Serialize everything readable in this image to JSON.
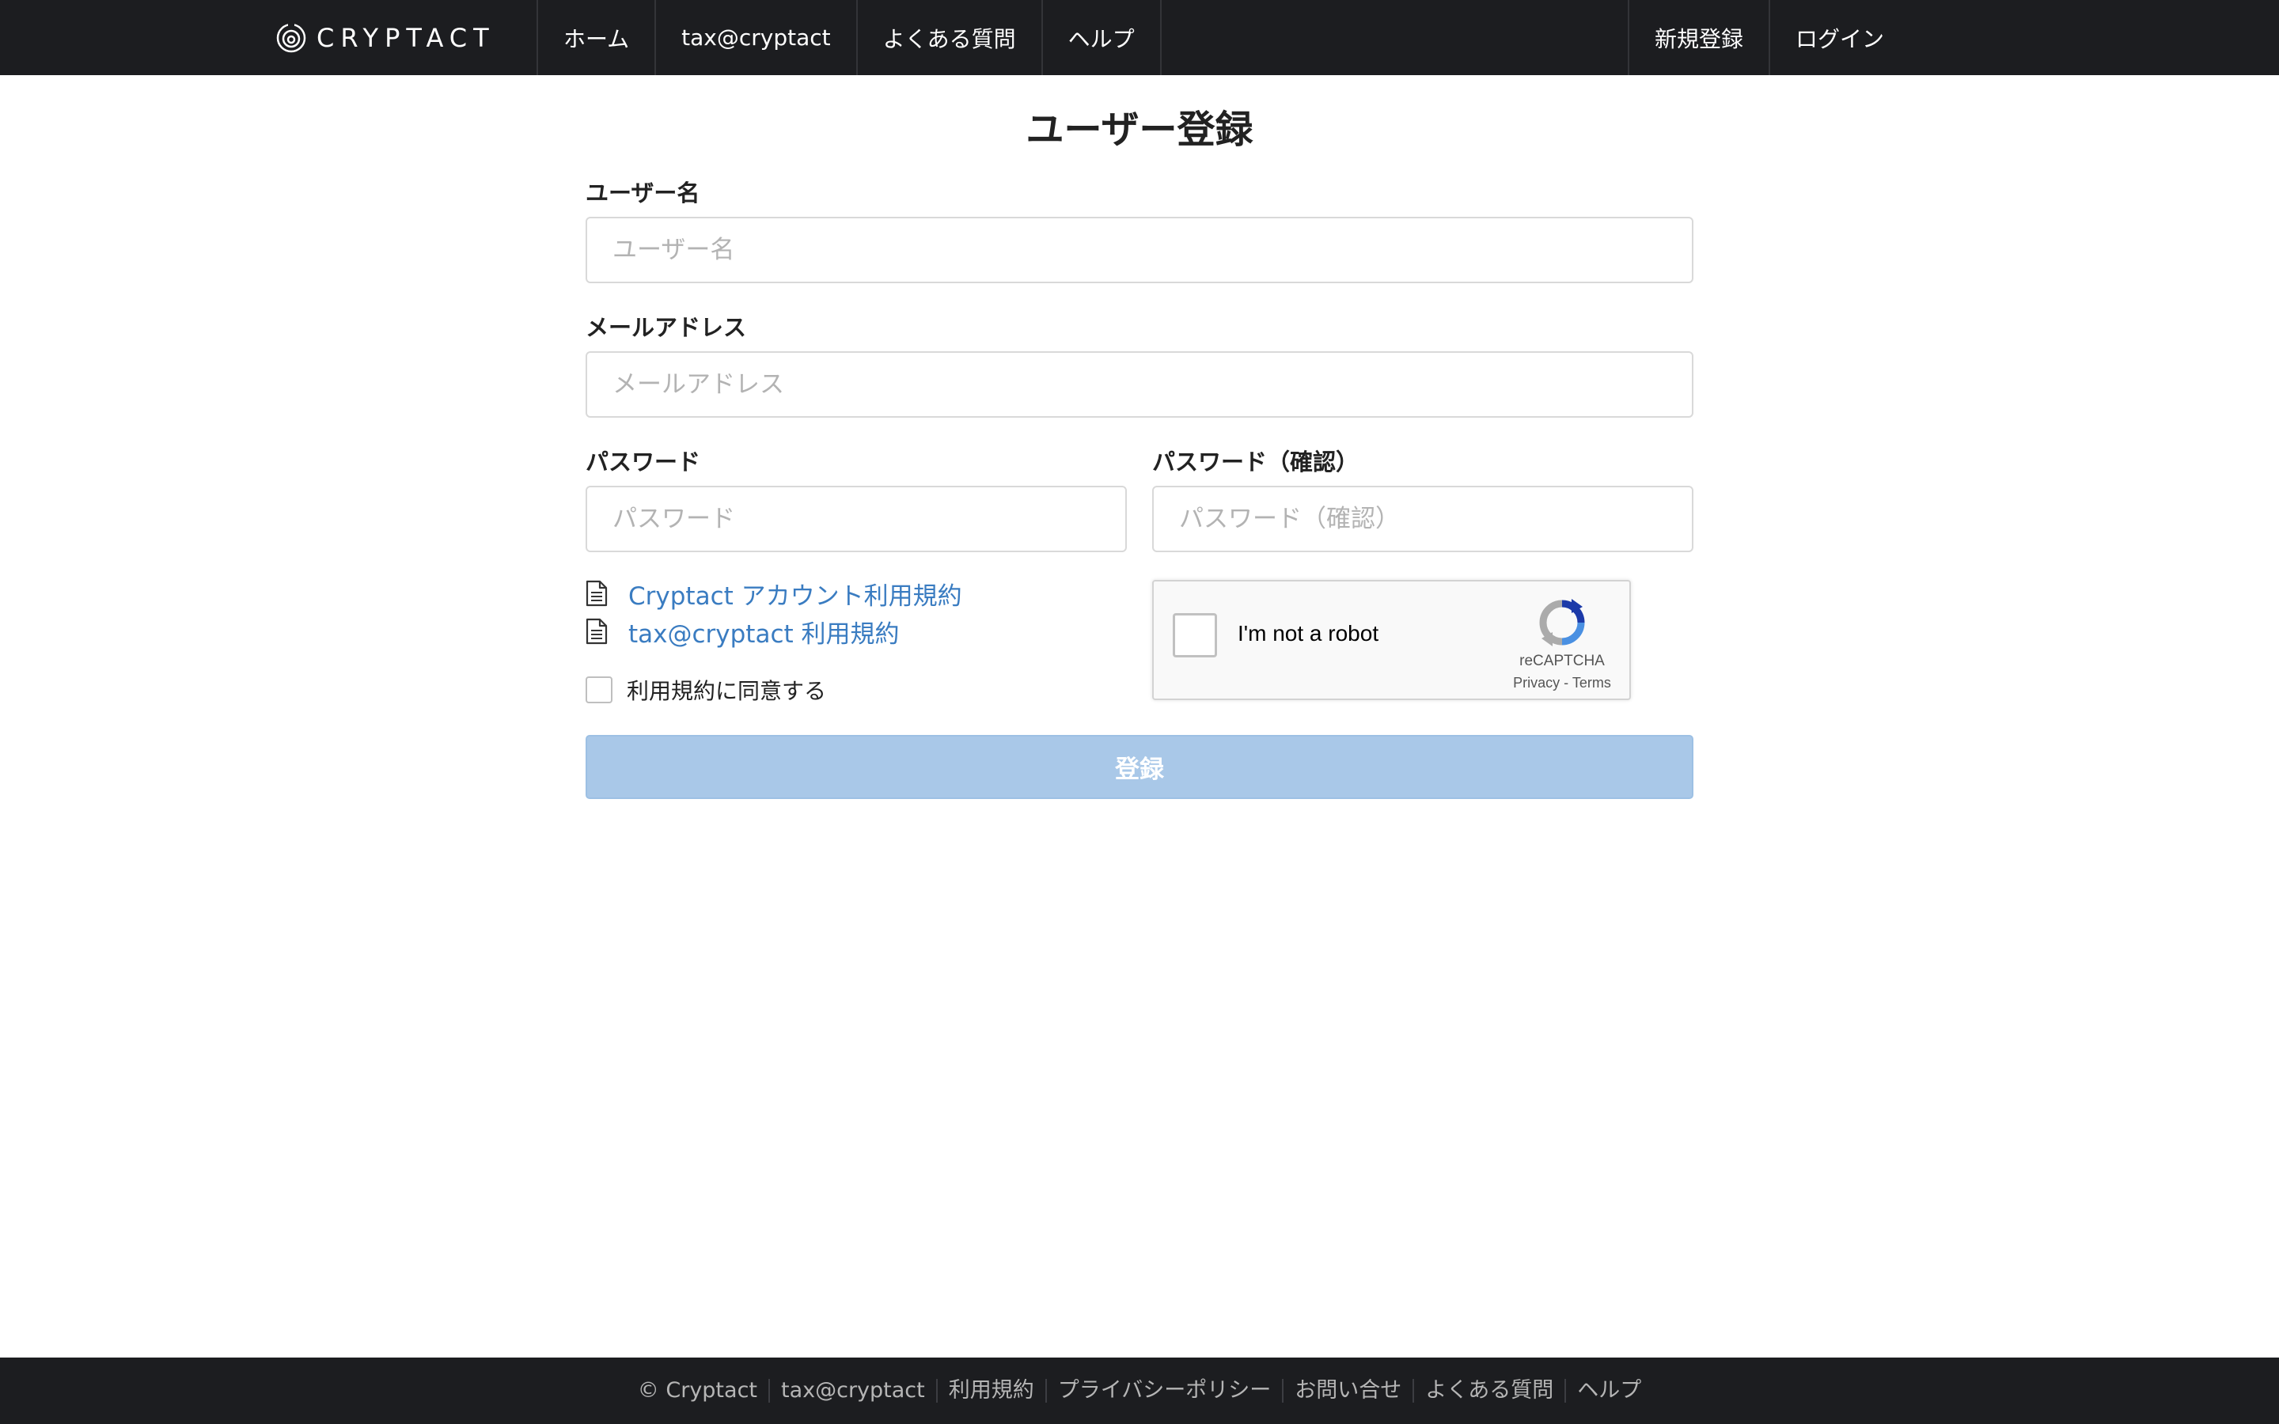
{
  "nav": {
    "brand": "CRYPTACT",
    "left_items": [
      "ホーム",
      "tax@cryptact",
      "よくある質問",
      "ヘルプ"
    ],
    "right_items": [
      "新規登録",
      "ログイン"
    ]
  },
  "form": {
    "title": "ユーザー登録",
    "username": {
      "label": "ユーザー名",
      "placeholder": "ユーザー名"
    },
    "email": {
      "label": "メールアドレス",
      "placeholder": "メールアドレス"
    },
    "password": {
      "label": "パスワード",
      "placeholder": "パスワード"
    },
    "password_confirm": {
      "label": "パスワード（確認）",
      "placeholder": "パスワード（確認）"
    },
    "terms_links": [
      "Cryptact アカウント利用規約",
      "tax@cryptact 利用規約"
    ],
    "agree_label": "利用規約に同意する",
    "submit_label": "登録"
  },
  "recaptcha": {
    "label": "I'm not a robot",
    "brand": "reCAPTCHA",
    "privacy": "Privacy",
    "separator": " - ",
    "terms": "Terms"
  },
  "footer": {
    "items": [
      "© Cryptact",
      "tax@cryptact",
      "利用規約",
      "プライバシーポリシー",
      "お問い合せ",
      "よくある質問",
      "ヘルプ"
    ]
  },
  "colors": {
    "navbar_bg": "#1c1d20",
    "link": "#3a7cc1",
    "submit_disabled": "#a9c8e8"
  }
}
